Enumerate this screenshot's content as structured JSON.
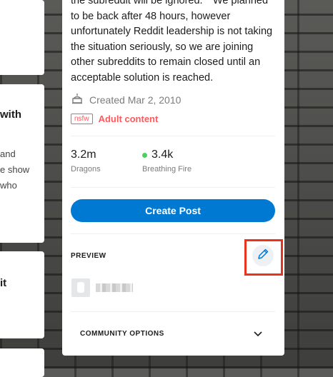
{
  "left_cards": [
    {
      "heading": "with",
      "lines": []
    },
    {
      "heading": "",
      "lines": [
        "and",
        "e show",
        "who"
      ]
    },
    {
      "heading": "it",
      "lines": []
    }
  ],
  "sidebar": {
    "description": "the subreddit will be ignored.\"\" We planned to be back after 48 hours, however unfortunately Reddit leadership is not taking the situation seriously, so we are joining other subreddits to remain closed until an acceptable solution is reached.",
    "created": "Created Mar 2, 2010",
    "nsfw_tag": "nsfw",
    "adult_label": "Adult content",
    "members_count": "3.2m",
    "members_label": "Dragons",
    "online_count": "3.4k",
    "online_label": "Breathing Fire",
    "online_color": "#46d160",
    "create_post_label": "Create Post",
    "preview_label": "PREVIEW",
    "community_options_label": "COMMUNITY OPTIONS"
  },
  "colors": {
    "primary": "#0079d3",
    "nsfw": "#ff585b",
    "highlight": "#e8341c"
  }
}
